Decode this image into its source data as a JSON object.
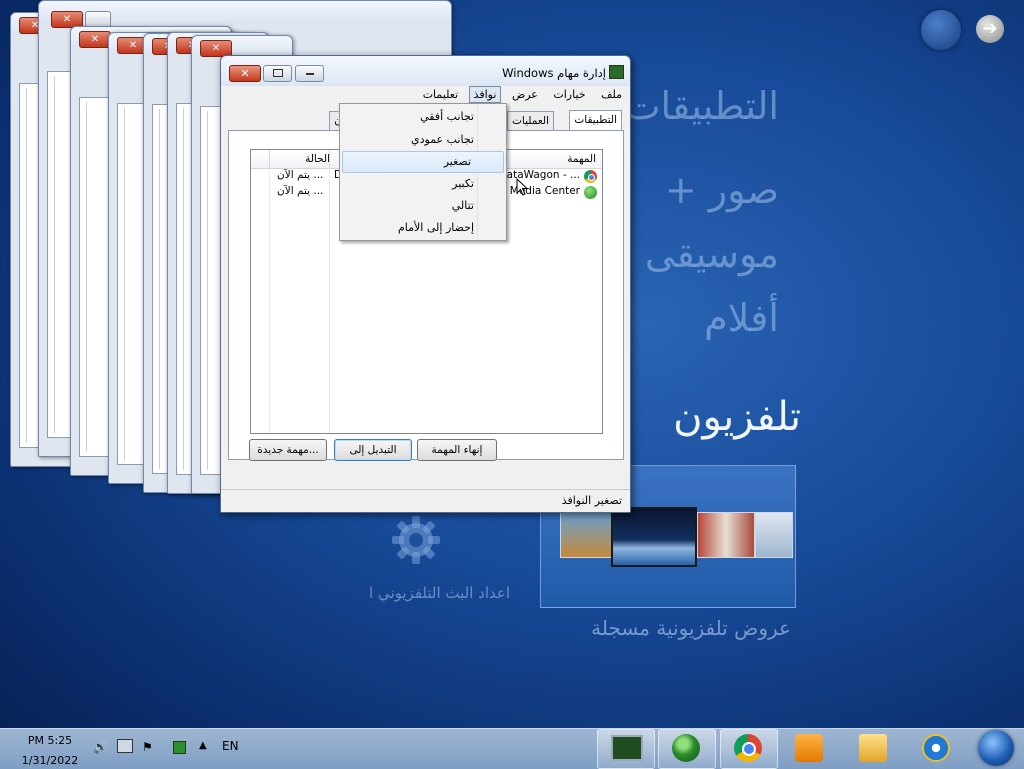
{
  "wmc": {
    "menu": [
      "التطبيقات",
      "صور +",
      "موسيقى",
      "أفلام",
      "تلفزيون"
    ],
    "recorded_tv": "عروض تلفزيونية مسجلة",
    "tv_setup": "اعداد البث التلفزيوني ا",
    "back_icon": "arrow-right-icon",
    "colors": {
      "background": "#174a98",
      "menu_text": "#a0c3eb"
    }
  },
  "window": {
    "title": "إدارة مهام Windows",
    "close_glyph": "✕",
    "menu": {
      "file": "ملف",
      "options": "خيارات",
      "view": "عرض",
      "windows": "نوافذ",
      "help": "تعليمات"
    },
    "tabs": {
      "applications": "التطبيقات",
      "processes": "العمليات",
      "services": "مون"
    },
    "columns": {
      "task": "المهمة",
      "status": "الحالة"
    },
    "rows": [
      {
        "task": "DataWagon - ...",
        "status": "يتم الآن ...",
        "extra": "D",
        "icon": "chrome-icon"
      },
      {
        "task": "s Media Center",
        "status": "يتم الآن ...",
        "extra": "",
        "icon": "media-center-icon"
      }
    ],
    "buttons": {
      "end_task": "إنهاء المهمة",
      "switch_to": "التبديل إلى",
      "new_task": "مهمة جديدة..."
    },
    "status_text": "تصغير النوافذ"
  },
  "windows_menu": {
    "items": [
      "تجانب أفقي",
      "تجانب عمودي",
      "تصغير",
      "تكبير",
      "تتالي",
      "إحضار إلى الأمام"
    ],
    "highlighted_index": 2
  },
  "taskbar": {
    "time": "PM 5:25",
    "date": "1/31/2022",
    "language": "EN",
    "apps": [
      "task-manager-icon",
      "media-center-icon",
      "chrome-icon",
      "media-player-icon",
      "explorer-icon",
      "ie-icon",
      "start-orb-icon"
    ]
  }
}
